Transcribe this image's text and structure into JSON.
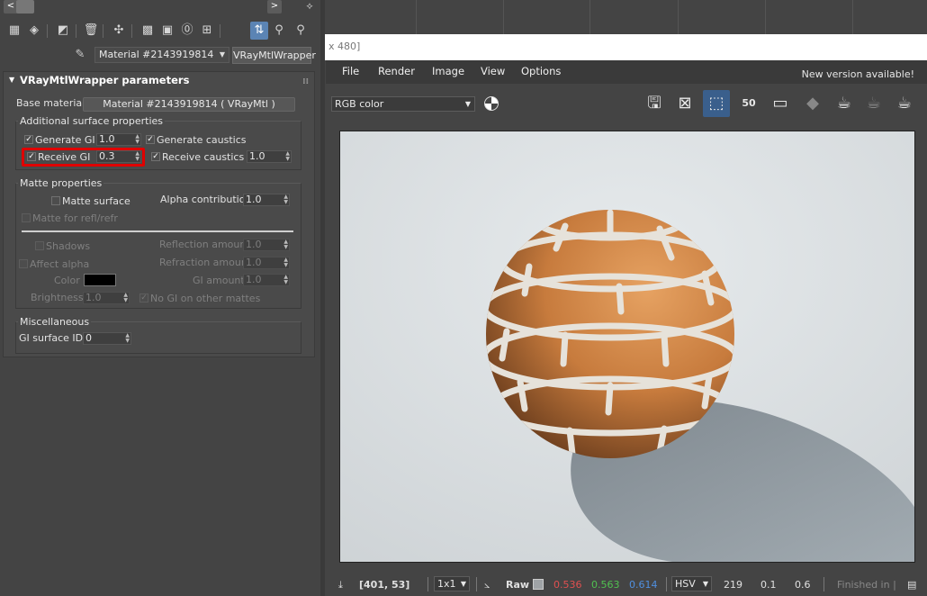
{
  "editor": {
    "nav": {
      "prev": "<",
      "next": ">"
    },
    "material_name": "Material #2143919814",
    "material_type": "VRayMtlWrapper",
    "rollout_title": "VRayMtlWrapper parameters",
    "base_material_label": "Base material:",
    "base_material_value": "Material #2143919814  ( VRayMtl )",
    "additional": {
      "title": "Additional surface properties",
      "generate_gi_label": "Generate GI",
      "generate_gi_value": "1.0",
      "generate_caustics_label": "Generate caustics",
      "receive_gi_label": "Receive GI",
      "receive_gi_value": "0.3",
      "receive_caustics_label": "Receive caustics",
      "receive_caustics_value": "1.0"
    },
    "matte": {
      "title": "Matte properties",
      "matte_surface_label": "Matte surface",
      "alpha_contribution_label": "Alpha contribution",
      "alpha_contribution_value": "1.0",
      "matte_refl_label": "Matte for refl/refr",
      "shadows_label": "Shadows",
      "reflection_amount_label": "Reflection amount",
      "reflection_amount_value": "1.0",
      "affect_alpha_label": "Affect alpha",
      "refraction_amount_label": "Refraction amount",
      "refraction_amount_value": "1.0",
      "color_label": "Color",
      "color_swatch": "#000000",
      "gi_amount_label": "GI amount",
      "gi_amount_value": "1.0",
      "brightness_label": "Brightness",
      "brightness_value": "1.0",
      "no_gi_label": "No GI on other mattes"
    },
    "misc": {
      "title": "Miscellaneous",
      "gi_surface_id_label": "GI surface ID",
      "gi_surface_id_value": "0"
    },
    "highlight_color": "#e00000"
  },
  "viewport": {
    "resolution_fragment": "x 480]"
  },
  "vfb": {
    "menu": [
      "File",
      "Render",
      "Image",
      "View",
      "Options"
    ],
    "new_version": "New version available!",
    "channel": "RGB color",
    "zoom_icon_label": "50",
    "status": {
      "coords": "[401, 53]",
      "sampling": "1x1",
      "mode": "Raw",
      "r": "0.536",
      "g": "0.563",
      "b": "0.614",
      "color_space": "HSV",
      "h": "219",
      "s": "0.1",
      "v": "0.6",
      "finished": "Finished in |"
    },
    "status_colors": {
      "r": "#e05050",
      "g": "#50c050",
      "b": "#5090e0"
    },
    "accent": "#3a5f8c"
  }
}
